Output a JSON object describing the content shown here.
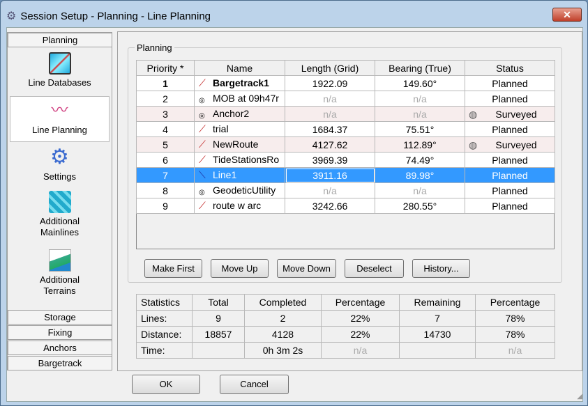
{
  "window": {
    "title": "Session Setup - Planning -  Line Planning",
    "close": "✕"
  },
  "sidebar": {
    "header": "Planning",
    "items": [
      {
        "label": "Line Databases"
      },
      {
        "label": "Line Planning"
      },
      {
        "label": "Settings"
      },
      {
        "label": "Additional Mainlines"
      },
      {
        "label": "Additional Terrains"
      }
    ],
    "sections": [
      "Storage",
      "Fixing",
      "Anchors",
      "Bargetrack"
    ]
  },
  "planning": {
    "group_label": "Planning",
    "columns": [
      "Priority *",
      "Name",
      "Length (Grid)",
      "Bearing (True)",
      "Status"
    ],
    "rows": [
      {
        "priority": "1",
        "name": "Bargetrack1",
        "type": "route",
        "length": "1922.09",
        "bearing": "149.60°",
        "status": "Planned"
      },
      {
        "priority": "2",
        "name": "MOB at 09h47r",
        "type": "point",
        "length": "n/a",
        "bearing": "n/a",
        "status": "Planned"
      },
      {
        "priority": "3",
        "name": "Anchor2",
        "type": "point",
        "length": "n/a",
        "bearing": "n/a",
        "status": "Surveyed"
      },
      {
        "priority": "4",
        "name": "trial",
        "type": "route",
        "length": "1684.37",
        "bearing": "75.51°",
        "status": "Planned"
      },
      {
        "priority": "5",
        "name": "NewRoute",
        "type": "route",
        "length": "4127.62",
        "bearing": "112.89°",
        "status": "Surveyed"
      },
      {
        "priority": "6",
        "name": "TideStationsRo",
        "type": "route",
        "length": "3969.39",
        "bearing": "74.49°",
        "status": "Planned"
      },
      {
        "priority": "7",
        "name": "Line1",
        "type": "line",
        "length": "3911.16",
        "bearing": "89.98°",
        "status": "Planned"
      },
      {
        "priority": "8",
        "name": "GeodeticUtility",
        "type": "point",
        "length": "n/a",
        "bearing": "n/a",
        "status": "Planned"
      },
      {
        "priority": "9",
        "name": "route w arc",
        "type": "route",
        "length": "3242.66",
        "bearing": "280.55°",
        "status": "Planned"
      }
    ],
    "buttons": {
      "make_first": "Make First",
      "move_up": "Move Up",
      "move_down": "Move Down",
      "deselect": "Deselect",
      "history": "History..."
    }
  },
  "statistics": {
    "columns": [
      "Statistics",
      "Total",
      "Completed",
      "Percentage",
      "Remaining",
      "Percentage"
    ],
    "rows": [
      [
        "Lines:",
        "9",
        "2",
        "22%",
        "7",
        "78%"
      ],
      [
        "Distance:",
        "18857",
        "4128",
        "22%",
        "14730",
        "78%"
      ],
      [
        "Time:",
        "",
        "0h 3m 2s",
        "n/a",
        "",
        "n/a"
      ]
    ]
  },
  "footer": {
    "ok": "OK",
    "cancel": "Cancel"
  }
}
